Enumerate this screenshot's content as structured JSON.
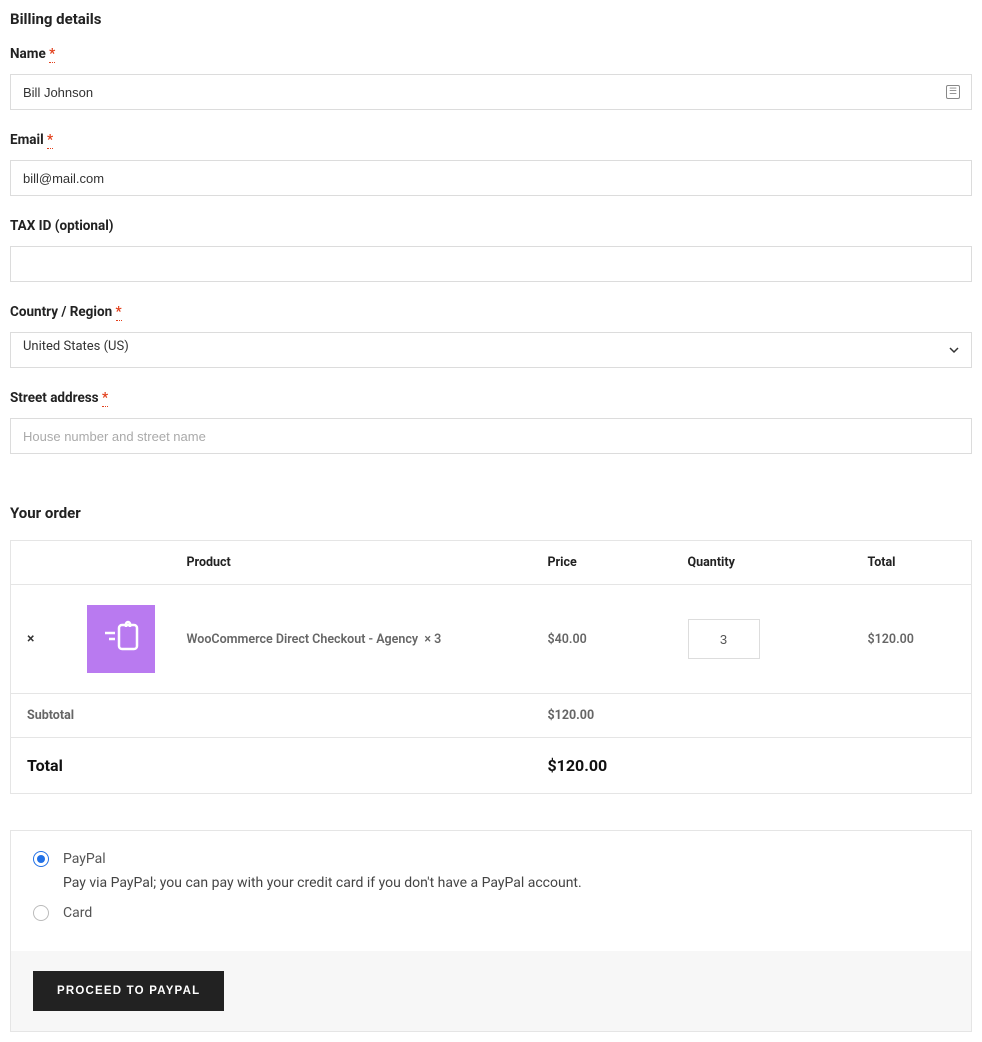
{
  "billing": {
    "title": "Billing details",
    "name": {
      "label": "Name",
      "value": "Bill Johnson",
      "required": "*"
    },
    "email": {
      "label": "Email",
      "value": "bill@mail.com",
      "required": "*"
    },
    "tax_id": {
      "label": "TAX ID (optional)",
      "value": ""
    },
    "country": {
      "label": "Country / Region",
      "value": "United States (US)",
      "required": "*"
    },
    "street": {
      "label": "Street address",
      "value": "",
      "placeholder": "House number and street name",
      "required": "*"
    }
  },
  "order": {
    "title": "Your order",
    "headers": {
      "product": "Product",
      "price": "Price",
      "quantity": "Quantity",
      "total": "Total"
    },
    "item": {
      "name": "WooCommerce Direct Checkout - Agency",
      "qty_inline": "× 3",
      "price": "$40.00",
      "quantity": "3",
      "total": "$120.00"
    },
    "subtotal": {
      "label": "Subtotal",
      "value": "$120.00"
    },
    "total": {
      "label": "Total",
      "value": "$120.00"
    }
  },
  "payment": {
    "paypal": {
      "label": "PayPal",
      "desc": "Pay via PayPal; you can pay with your credit card if you don't have a PayPal account."
    },
    "card": {
      "label": "Card"
    },
    "proceed": "PROCEED TO PAYPAL"
  }
}
